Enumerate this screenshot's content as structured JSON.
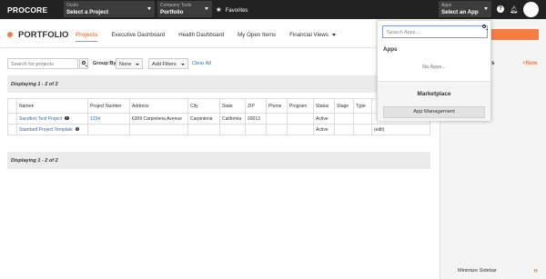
{
  "topbar": {
    "logo": "PROCORE",
    "project_selector": {
      "small": "Oculo",
      "main": "Select a Project"
    },
    "tools_selector": {
      "small": "Company Tools",
      "main": "Portfolio"
    },
    "favorites": "Favorites",
    "apps_selector": {
      "small": "Apps",
      "main": "Select an App"
    },
    "help_glyph": "?"
  },
  "header": {
    "title": "PORTFOLIO",
    "tabs": [
      {
        "label": "Projects",
        "active": true
      },
      {
        "label": "Executive Dashboard"
      },
      {
        "label": "Health Dashboard"
      },
      {
        "label": "My Open Items"
      },
      {
        "label": "Financial Views"
      }
    ]
  },
  "filters": {
    "search_placeholder": "Search for projects",
    "group_by_label": "Group By:",
    "group_by_value": "None",
    "add_filters": "Add Filters",
    "clear_all": "Clear All"
  },
  "display_text": "Displaying 1 - 2 of 2",
  "table": {
    "columns": [
      "Name▾",
      "Project Number",
      "Address",
      "City",
      "State",
      "ZIP",
      "Phone",
      "Program",
      "Status",
      "Stage",
      "Type"
    ],
    "rows": [
      {
        "name": "Sandbox Test Project",
        "number": "1234",
        "address": "6309 Carpinteria Avenue",
        "city": "Carpinteria",
        "state": "California",
        "zip": "93013",
        "phone": "",
        "program": "",
        "status": "Active",
        "stage": "",
        "type": ""
      },
      {
        "name": "Standard Project Template",
        "number": "",
        "address": "",
        "city": "",
        "state": "",
        "zip": "",
        "phone": "",
        "program": "",
        "status": "Active",
        "stage": "",
        "type": "",
        "edit": "(edit)"
      }
    ]
  },
  "sidebar": {
    "partial_heading": "s",
    "new_label": "+New",
    "minimize_label": "Minimize Sidebar"
  },
  "apps_menu": {
    "search_placeholder": "Search Apps...",
    "heading": "Apps",
    "empty_text": "No Apps...",
    "marketplace": "Marketplace",
    "app_management": "App Management"
  },
  "colors": {
    "accent": "#f47e42",
    "link": "#2a6ebb",
    "topbar": "#222222"
  }
}
